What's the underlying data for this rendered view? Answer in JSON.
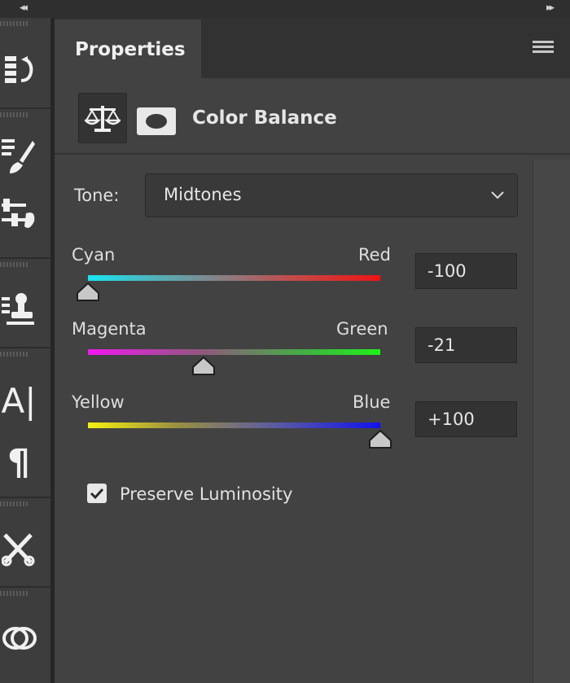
{
  "window": {
    "collapse_left": "◂◂",
    "collapse_right": "▸▸"
  },
  "toolstrip": {
    "tools": [
      {
        "icon": "history-icon"
      },
      {
        "icon": "brush-icon"
      },
      {
        "icon": "brush-settings-icon"
      },
      {
        "icon": "clone-stamp-icon"
      },
      {
        "icon": "character-icon"
      },
      {
        "icon": "paragraph-icon"
      },
      {
        "icon": "tool-presets-icon"
      },
      {
        "icon": "libraries-icon"
      }
    ],
    "character_glyph": "A|",
    "paragraph_glyph": "¶"
  },
  "panel": {
    "tab_title": "Properties",
    "adjustment_title": "Color Balance",
    "tone": {
      "label": "Tone:",
      "selected": "Midtones"
    },
    "sliders": [
      {
        "left_label": "Cyan",
        "right_label": "Red",
        "value": -100,
        "display": "-100",
        "min": -100,
        "max": 100
      },
      {
        "left_label": "Magenta",
        "right_label": "Green",
        "value": -21,
        "display": "-21",
        "min": -100,
        "max": 100
      },
      {
        "left_label": "Yellow",
        "right_label": "Blue",
        "value": 100,
        "display": "+100",
        "min": -100,
        "max": 100
      }
    ],
    "preserve_luminosity": {
      "label": "Preserve Luminosity",
      "checked": true
    }
  }
}
